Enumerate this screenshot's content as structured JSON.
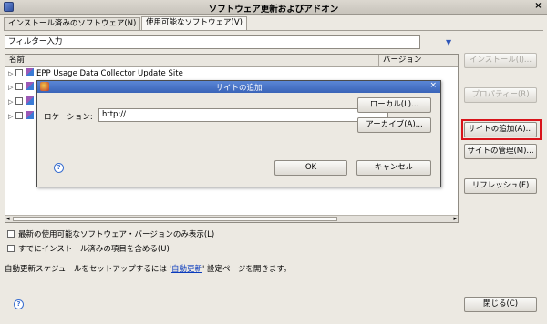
{
  "window": {
    "title": "ソフトウェア更新およびアドオン",
    "close_glyph": "×"
  },
  "tabs": [
    {
      "label": "インストール済みのソフトウェア(N)",
      "active": false
    },
    {
      "label": "使用可能なソフトウェア(V)",
      "active": true
    }
  ],
  "filter": {
    "placeholder": "フィルター入力",
    "dropdown_glyph": "▼"
  },
  "table": {
    "columns": [
      "名前",
      "バージョン"
    ],
    "rows": [
      {
        "name": "EPP Usage Data Collector Update Site",
        "version": ""
      },
      {
        "name": "",
        "version": ""
      },
      {
        "name": "",
        "version": ""
      },
      {
        "name": "",
        "version": ""
      }
    ],
    "tree_glyph": "▷",
    "scroll_left": "◂",
    "scroll_right": "▸"
  },
  "side_buttons": {
    "install": "インストール(I)...",
    "properties": "プロパティー(R)",
    "add_site": "サイトの追加(A)...",
    "manage_sites": "サイトの管理(M)...",
    "refresh": "リフレッシュ(F)"
  },
  "options": {
    "latest_only": "最新の使用可能なソフトウェア・バージョンのみ表示(L)",
    "include_installed": "すでにインストール済みの項目を含める(U)"
  },
  "auto_update": {
    "prefix": "自動更新スケジュールをセットアップするには '",
    "link": "自動更新",
    "suffix": "' 設定ページを開きます。"
  },
  "footer": {
    "help_glyph": "?",
    "close_button": "閉じる(C)"
  },
  "dialog": {
    "title": "サイトの追加",
    "close_glyph": "×",
    "location_label": "ロケーション:",
    "location_value": "http://",
    "local_button": "ローカル(L)...",
    "archive_button": "アーカイブ(A)...",
    "ok_button": "OK",
    "cancel_button": "キャンセル",
    "help_glyph": "?"
  },
  "colors": {
    "highlight": "#d8141b",
    "link": "#0a3bbd",
    "dialog_title": "#3a64b8"
  }
}
